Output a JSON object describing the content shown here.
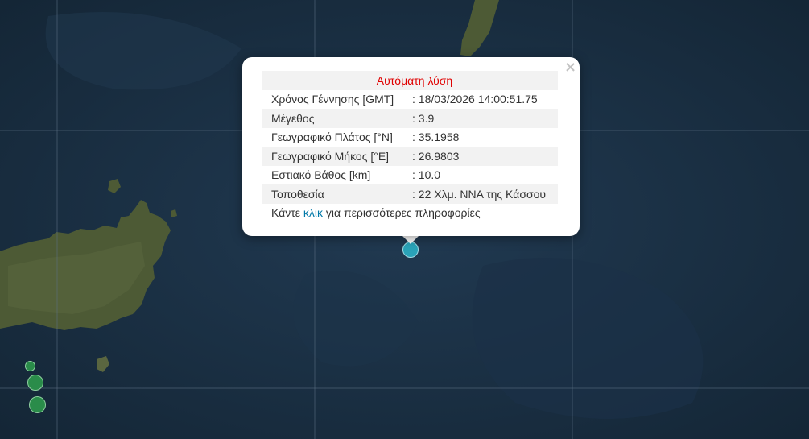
{
  "popup": {
    "header": "Αυτόματη λύση",
    "rows": [
      {
        "label": "Χρόνος Γέννησης [GMT]",
        "value": ": 18/03/2026 14:00:51.75"
      },
      {
        "label": "Μέγεθος",
        "value": ": 3.9"
      },
      {
        "label": "Γεωγραφικό Πλάτος [°N]",
        "value": ": 35.1958"
      },
      {
        "label": "Γεωγραφικό Μήκος [°E]",
        "value": ": 26.9803"
      },
      {
        "label": "Εστιακό Βάθος [km]",
        "value": ": 10.0"
      },
      {
        "label": "Τοποθεσία",
        "value": ": 22 Χλμ. ΝΝΑ της Κάσσου"
      }
    ],
    "footer_before": "Κάντε ",
    "footer_link": "κλικ",
    "footer_after": " για περισσότερες πληροφορίες",
    "close_symbol": "×"
  },
  "colors": {
    "sea": "#1a3044",
    "land": "#4d5a35",
    "selected_marker": "#2aa3b8",
    "other_markers": "#2a8c4a",
    "header_text": "#e00000",
    "link": "#0078a8"
  },
  "icons": {
    "close": "close-icon"
  }
}
